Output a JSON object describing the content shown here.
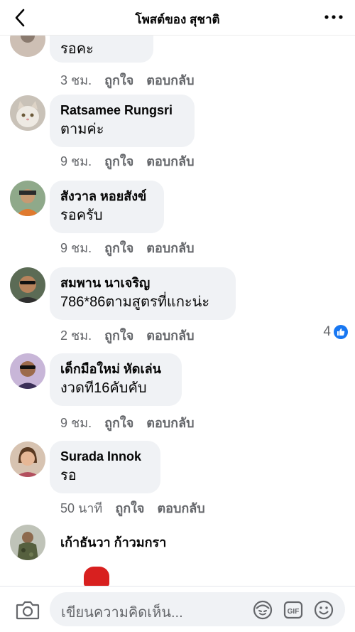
{
  "header": {
    "title": "โพสต์ของ สุชาติ"
  },
  "partial_comment": {
    "text": "รอคะ",
    "time": "3 ชม.",
    "like": "ถูกใจ",
    "reply": "ตอบกลับ"
  },
  "comments": [
    {
      "author": "Ratsamee Rungsri",
      "text": "ตามค่ะ",
      "time": "9 ชม.",
      "like": "ถูกใจ",
      "reply": "ตอบกลับ"
    },
    {
      "author": "สังวาล หอยสังข์",
      "text": "รอครับ",
      "time": "9 ชม.",
      "like": "ถูกใจ",
      "reply": "ตอบกลับ"
    },
    {
      "author": "สมพาน นาเจริญ",
      "text": "786*86ตามสูตรที่แกะน่ะ",
      "time": "2 ชม.",
      "like": "ถูกใจ",
      "reply": "ตอบกลับ",
      "reactions": "4"
    },
    {
      "author": "เด็กมือใหม่ หัดเล่น",
      "text": "งวดที16คับคับ",
      "time": "9 ชม.",
      "like": "ถูกใจ",
      "reply": "ตอบกลับ"
    },
    {
      "author": "Surada Innok",
      "text": "รอ",
      "time": "50 นาที",
      "like": "ถูกใจ",
      "reply": "ตอบกลับ"
    },
    {
      "author": "เก้าธันวา ก้าวมกรา"
    }
  ],
  "composer": {
    "placeholder": "เขียนความคิดเห็น..."
  },
  "icons": [
    "back-arrow-icon",
    "more-dots-icon",
    "camera-icon",
    "avatar-sticker-icon",
    "gif-icon",
    "emoji-icon",
    "like-thumb-icon"
  ],
  "colors": {
    "accent": "#1877f2",
    "bubble": "#f0f2f5",
    "meta": "#65676b"
  }
}
